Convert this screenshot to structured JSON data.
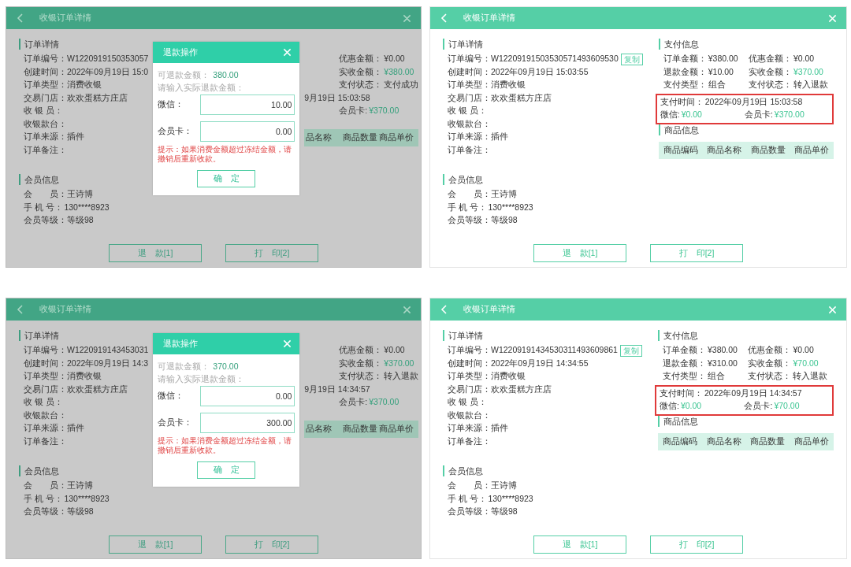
{
  "panels": [
    {
      "dimmed": true,
      "title": "收银订单详情",
      "order": {
        "title": "订单详情",
        "fields": [
          {
            "label": "订单编号：",
            "value": "W1220919150353057"
          },
          {
            "label": "创建时间：",
            "value": "2022年09月19日 15:0"
          },
          {
            "label": "订单类型：",
            "value": "消费收银"
          },
          {
            "label": "交易门店：",
            "value": "欢欢蛋糕方庄店"
          },
          {
            "label": "收 银 员："
          },
          {
            "label": "收银款台："
          },
          {
            "label": "订单来源：",
            "value": "插件"
          },
          {
            "label": "订单备注："
          }
        ]
      },
      "member": {
        "title": "会员信息",
        "fields": [
          {
            "label": "会　　员：",
            "value": "王诗博"
          },
          {
            "label": "手 机 号：",
            "value": "130****8923"
          },
          {
            "label": "会员等级：",
            "value": "等级98"
          }
        ]
      },
      "payment": {
        "rows": [
          [
            null,
            {
              "label": "优惠金额：",
              "value": "¥0.00",
              "accent": false
            }
          ],
          [
            null,
            {
              "label": "实收金额：",
              "value": "¥380.00",
              "accent": true
            }
          ],
          [
            null,
            {
              "label": "支付状态：",
              "value": "支付成功",
              "accent": false
            }
          ],
          [
            {
              "value": "9月19日 15:03:58",
              "accent": false
            }
          ],
          [
            null,
            {
              "label": "会员卡:",
              "value": "¥370.00",
              "accent": true
            }
          ]
        ]
      },
      "products": {
        "columns": [
          "品名称",
          "商品数量",
          "商品单价"
        ]
      },
      "dialog": {
        "title": "退款操作",
        "refundable_label": "可退款金额：",
        "refundable_value": "380.00",
        "prompt": "请输入实际退款金额：",
        "inputs": [
          {
            "label": "微信：",
            "value": "10.00"
          },
          {
            "label": "会员卡：",
            "value": "0.00"
          }
        ],
        "hint": "提示：如果消费金额超过冻结金额，请撤销后重新收款。",
        "confirm": "确　定"
      },
      "buttons": [
        "退　款[1]",
        "打　印[2]"
      ]
    },
    {
      "dimmed": false,
      "title": "收银订单详情",
      "order": {
        "title": "订单详情",
        "fields": [
          {
            "label": "订单编号：",
            "value": "W12209191503530571493609530",
            "copy_button": "复制"
          },
          {
            "label": "创建时间：",
            "value": "2022年09月19日 15:03:55"
          },
          {
            "label": "订单类型：",
            "value": "消费收银"
          },
          {
            "label": "交易门店：",
            "value": "欢欢蛋糕方庄店"
          },
          {
            "label": "收 银 员："
          },
          {
            "label": "收银款台："
          },
          {
            "label": "订单来源：",
            "value": "插件"
          },
          {
            "label": "订单备注："
          }
        ]
      },
      "member": {
        "title": "会员信息",
        "fields": [
          {
            "label": "会　　员：",
            "value": "王诗博"
          },
          {
            "label": "手 机 号：",
            "value": "130****8923"
          },
          {
            "label": "会员等级：",
            "value": "等级98"
          }
        ]
      },
      "payment": {
        "title": "支付信息",
        "rows": [
          [
            {
              "label": "订单金额：",
              "value": "¥380.00",
              "accent": false
            },
            {
              "label": "优惠金额：",
              "value": "¥0.00",
              "accent": false
            }
          ],
          [
            {
              "label": "退款金额：",
              "value": "¥10.00",
              "accent": false
            },
            {
              "label": "实收金额：",
              "value": "¥370.00",
              "accent": true
            }
          ],
          [
            {
              "label": "支付类型：",
              "value": "组合",
              "accent": false
            },
            {
              "label": "支付状态：",
              "value": "转入退款",
              "accent": false
            }
          ]
        ],
        "highlight_rows": [
          [
            {
              "label": "支付时间：",
              "value": "2022年09月19日 15:03:58",
              "accent": false
            }
          ],
          [
            {
              "label": "微信:",
              "value": "¥0.00",
              "accent": true
            },
            {
              "label": "会员卡:",
              "value": "¥370.00",
              "accent": true
            }
          ]
        ]
      },
      "products": {
        "title": "商品信息",
        "columns": [
          "商品编码",
          "商品名称",
          "商品数量",
          "商品单价"
        ]
      },
      "buttons": [
        "退　款[1]",
        "打　印[2]"
      ]
    },
    {
      "dimmed": true,
      "title": "收银订单详情",
      "order": {
        "title": "订单详情",
        "fields": [
          {
            "label": "订单编号：",
            "value": "W1220919143453031"
          },
          {
            "label": "创建时间：",
            "value": "2022年09月19日 14:3"
          },
          {
            "label": "订单类型：",
            "value": "消费收银"
          },
          {
            "label": "交易门店：",
            "value": "欢欢蛋糕方庄店"
          },
          {
            "label": "收 银 员："
          },
          {
            "label": "收银款台："
          },
          {
            "label": "订单来源：",
            "value": "插件"
          },
          {
            "label": "订单备注："
          }
        ]
      },
      "member": {
        "title": "会员信息",
        "fields": [
          {
            "label": "会　　员：",
            "value": "王诗博"
          },
          {
            "label": "手 机 号：",
            "value": "130****8923"
          },
          {
            "label": "会员等级：",
            "value": "等级98"
          }
        ]
      },
      "payment": {
        "rows": [
          [
            null,
            {
              "label": "优惠金额：",
              "value": "¥0.00",
              "accent": false
            }
          ],
          [
            null,
            {
              "label": "实收金额：",
              "value": "¥370.00",
              "accent": true
            }
          ],
          [
            null,
            {
              "label": "支付状态：",
              "value": "转入退款",
              "accent": false
            }
          ],
          [
            {
              "value": "9月19日 14:34:57",
              "accent": false
            }
          ],
          [
            null,
            {
              "label": "会员卡:",
              "value": "¥370.00",
              "accent": true
            }
          ]
        ]
      },
      "products": {
        "columns": [
          "品名称",
          "商品数量",
          "商品单价"
        ]
      },
      "dialog": {
        "title": "退款操作",
        "refundable_label": "可退款金额：",
        "refundable_value": "370.00",
        "prompt": "请输入实际退款金额：",
        "inputs": [
          {
            "label": "微信：",
            "value": "0.00"
          },
          {
            "label": "会员卡：",
            "value": "300.00"
          }
        ],
        "hint": "提示：如果消费金额超过冻结金额，请撤销后重新收款。",
        "confirm": "确　定"
      },
      "buttons": [
        "退　款[1]",
        "打　印[2]"
      ]
    },
    {
      "dimmed": false,
      "title": "收银订单详情",
      "order": {
        "title": "订单详情",
        "fields": [
          {
            "label": "订单编号：",
            "value": "W12209191434530311493609861",
            "copy_button": "复制"
          },
          {
            "label": "创建时间：",
            "value": "2022年09月19日 14:34:55"
          },
          {
            "label": "订单类型：",
            "value": "消费收银"
          },
          {
            "label": "交易门店：",
            "value": "欢欢蛋糕方庄店"
          },
          {
            "label": "收 银 员："
          },
          {
            "label": "收银款台："
          },
          {
            "label": "订单来源：",
            "value": "插件"
          },
          {
            "label": "订单备注："
          }
        ]
      },
      "member": {
        "title": "会员信息",
        "fields": [
          {
            "label": "会　　员：",
            "value": "王诗博"
          },
          {
            "label": "手 机 号：",
            "value": "130****8923"
          },
          {
            "label": "会员等级：",
            "value": "等级98"
          }
        ]
      },
      "payment": {
        "title": "支付信息",
        "rows": [
          [
            {
              "label": "订单金额：",
              "value": "¥380.00",
              "accent": false
            },
            {
              "label": "优惠金额：",
              "value": "¥0.00",
              "accent": false
            }
          ],
          [
            {
              "label": "退款金额：",
              "value": "¥310.00",
              "accent": false
            },
            {
              "label": "实收金额：",
              "value": "¥70.00",
              "accent": true
            }
          ],
          [
            {
              "label": "支付类型：",
              "value": "组合",
              "accent": false
            },
            {
              "label": "支付状态：",
              "value": "转入退款",
              "accent": false
            }
          ]
        ],
        "highlight_rows": [
          [
            {
              "label": "支付时间：",
              "value": "2022年09月19日 14:34:57",
              "accent": false
            }
          ],
          [
            {
              "label": "微信:",
              "value": "¥0.00",
              "accent": true
            },
            {
              "label": "会员卡:",
              "value": "¥70.00",
              "accent": true
            }
          ]
        ]
      },
      "products": {
        "title": "商品信息",
        "columns": [
          "商品编码",
          "商品名称",
          "商品数量",
          "商品单价"
        ]
      },
      "buttons": [
        "退　款[1]",
        "打　印[2]"
      ]
    }
  ]
}
